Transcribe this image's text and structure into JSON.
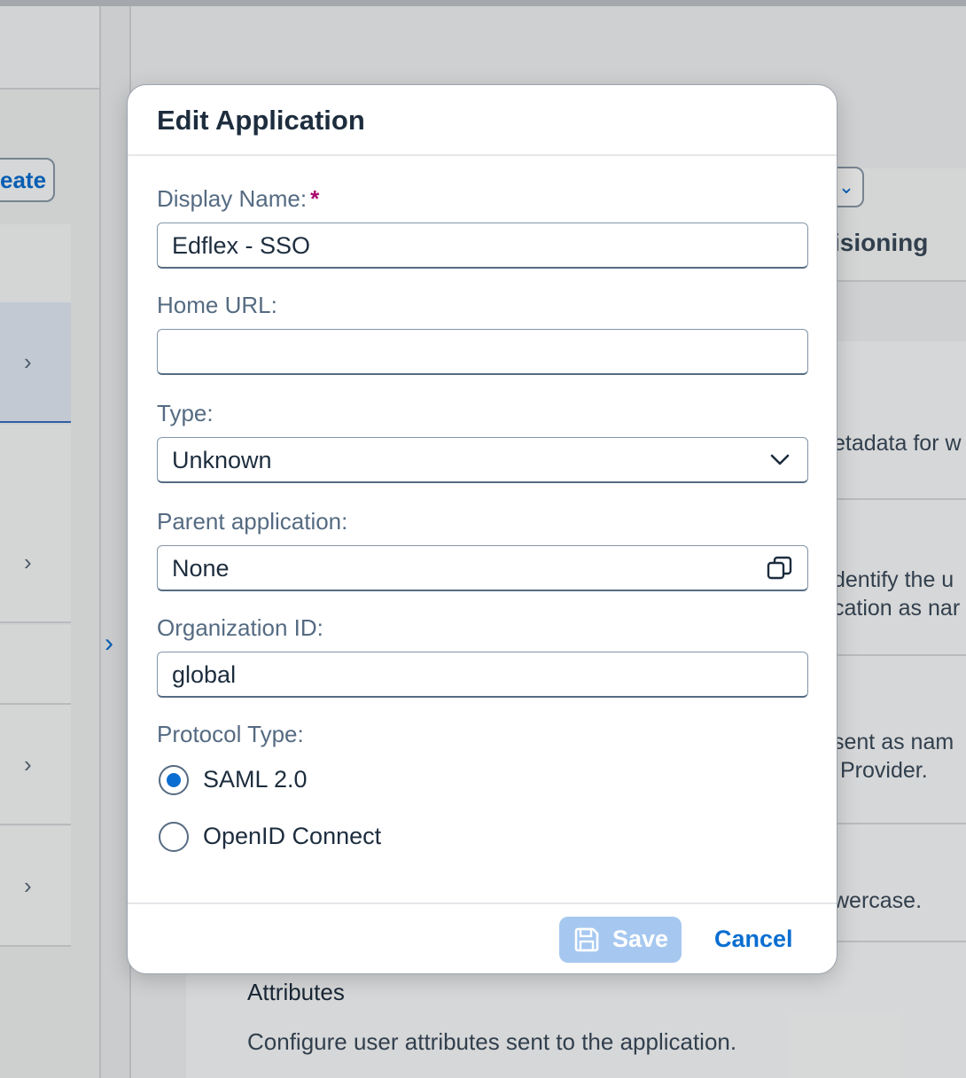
{
  "background": {
    "create_button_label": "eate",
    "tab_label": "isioning",
    "snippets": [
      "etadata for w",
      "dentify the u",
      "cation as nar",
      "sent as nam",
      "Provider.",
      "wercase."
    ],
    "attributes_title": "Attributes",
    "attributes_description": "Configure user attributes sent to the application."
  },
  "dialog": {
    "title": "Edit Application",
    "display_name": {
      "label": "Display Name:",
      "required_mark": "*",
      "value": "Edflex - SSO"
    },
    "home_url": {
      "label": "Home URL:",
      "value": ""
    },
    "type": {
      "label": "Type:",
      "value": "Unknown"
    },
    "parent_application": {
      "label": "Parent application:",
      "value": "None"
    },
    "organization_id": {
      "label": "Organization ID:",
      "value": "global"
    },
    "protocol_type": {
      "label": "Protocol Type:",
      "options": [
        {
          "label": "SAML 2.0",
          "selected": true
        },
        {
          "label": "OpenID Connect",
          "selected": false
        }
      ]
    },
    "footer": {
      "save_label": "Save",
      "cancel_label": "Cancel"
    }
  },
  "colors": {
    "accent": "#0a6ed1",
    "required": "#aa0a6d",
    "save_disabled_bg": "#a6c8f0"
  },
  "icons": {
    "type_dropdown": "chevron-down-icon",
    "parent_selector": "value-help-icon",
    "save": "save-icon",
    "list_rows": "chevron-right-icon",
    "side_toggle": "chevron-right-icon"
  }
}
